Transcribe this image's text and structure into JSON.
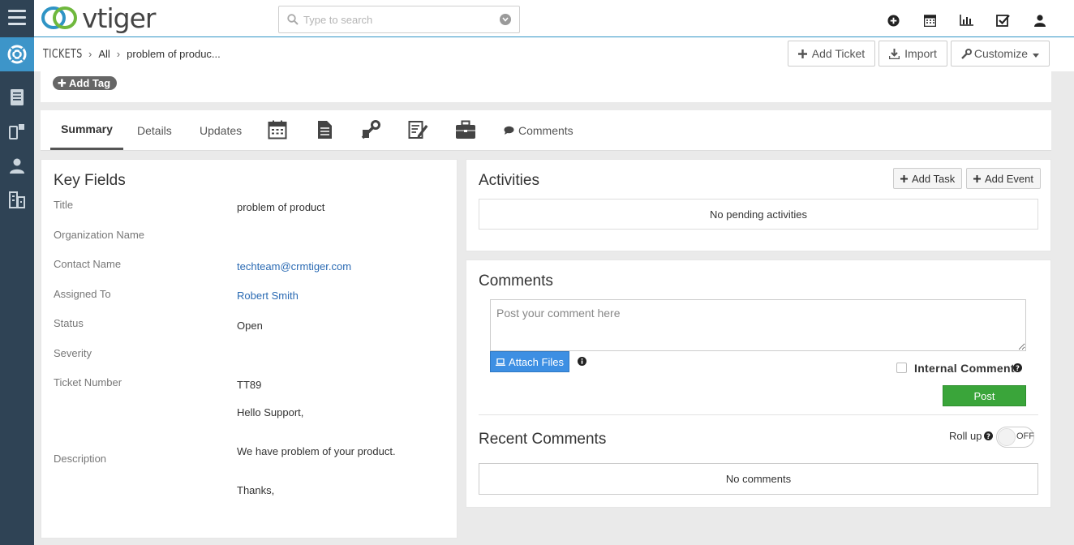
{
  "header": {
    "logo_text": "vtiger",
    "search_placeholder": "Type to search",
    "icons": [
      "plus-circle-icon",
      "calendar-icon",
      "chart-icon",
      "checkbox-icon",
      "user-icon"
    ]
  },
  "sidebar": {
    "icons": [
      "menu-icon",
      "lifebuoy-icon",
      "document-icon",
      "mobile-icon",
      "person-icon",
      "building-icon"
    ]
  },
  "breadcrumb": {
    "module": "TICKETS",
    "filter": "All",
    "record": "problem of produc..."
  },
  "actions": {
    "add_ticket": "Add Ticket",
    "import": "Import",
    "customize": "Customize"
  },
  "tag": {
    "add_tag": "Add Tag"
  },
  "tabs": {
    "summary": "Summary",
    "details": "Details",
    "updates": "Updates",
    "comments": "Comments"
  },
  "key_fields": {
    "title": "Key Fields",
    "fields": [
      {
        "label": "Title",
        "value": "problem of product"
      },
      {
        "label": "Organization Name",
        "value": ""
      },
      {
        "label": "Contact Name",
        "value": "techteam@crmtiger.com"
      },
      {
        "label": "Assigned To",
        "value": "Robert Smith"
      },
      {
        "label": "Status",
        "value": "Open"
      },
      {
        "label": "Severity",
        "value": ""
      },
      {
        "label": "Ticket Number",
        "value": "TT89"
      },
      {
        "label": "Description",
        "value": ""
      }
    ],
    "description_lines": [
      "Hello Support,",
      "We have problem of your product.",
      "Thanks,"
    ]
  },
  "activities": {
    "title": "Activities",
    "add_task": "Add Task",
    "add_event": "Add Event",
    "empty": "No pending activities"
  },
  "comments": {
    "title": "Comments",
    "placeholder": "Post your comment here",
    "attach_files": "Attach Files",
    "internal_comment": "Internal Comment",
    "post": "Post",
    "recent_title": "Recent Comments",
    "roll_up": "Roll up",
    "toggle_state": "OFF",
    "empty": "No comments"
  },
  "colors": {
    "sidebar": "#2f4355",
    "sidebar_active": "#3d95c9",
    "link": "#2a6ab3",
    "attach": "#3d8fe3",
    "post": "#3aa53a"
  }
}
